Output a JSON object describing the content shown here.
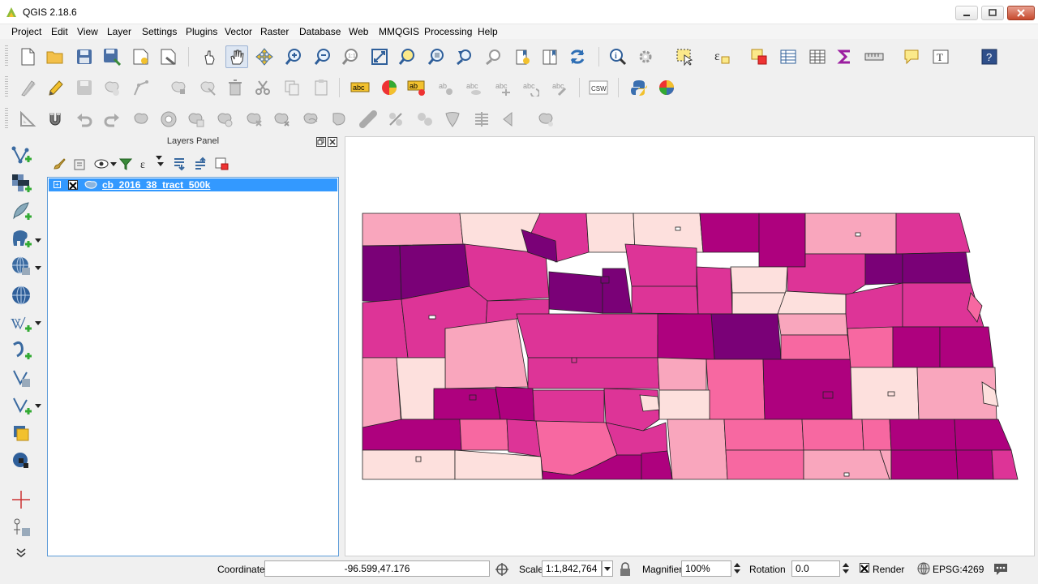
{
  "window": {
    "title": "QGIS 2.18.6"
  },
  "menu": [
    "Project",
    "Edit",
    "View",
    "Layer",
    "Settings",
    "Plugins",
    "Vector",
    "Raster",
    "Database",
    "Web",
    "MMQGIS",
    "Processing",
    "Help"
  ],
  "layers_panel": {
    "title": "Layers Panel",
    "layers": [
      {
        "name": "cb_2016_38_tract_500k",
        "visible": false,
        "selected": true
      }
    ]
  },
  "status": {
    "coordinate_label": "Coordinate",
    "coordinate_value": "-96.599,47.176",
    "scale_label": "Scale",
    "scale_value": "1:1,842,764",
    "magnifier_label": "Magnifier",
    "magnifier_value": "100%",
    "rotation_label": "Rotation",
    "rotation_value": "0.0",
    "render_label": "Render",
    "crs": "EPSG:4269"
  },
  "colors": {
    "selection": "#3399ff",
    "choropleth": [
      "#fde0dd",
      "#f9a6bd",
      "#f768a1",
      "#dd3497",
      "#ae017e",
      "#7a0177"
    ]
  }
}
